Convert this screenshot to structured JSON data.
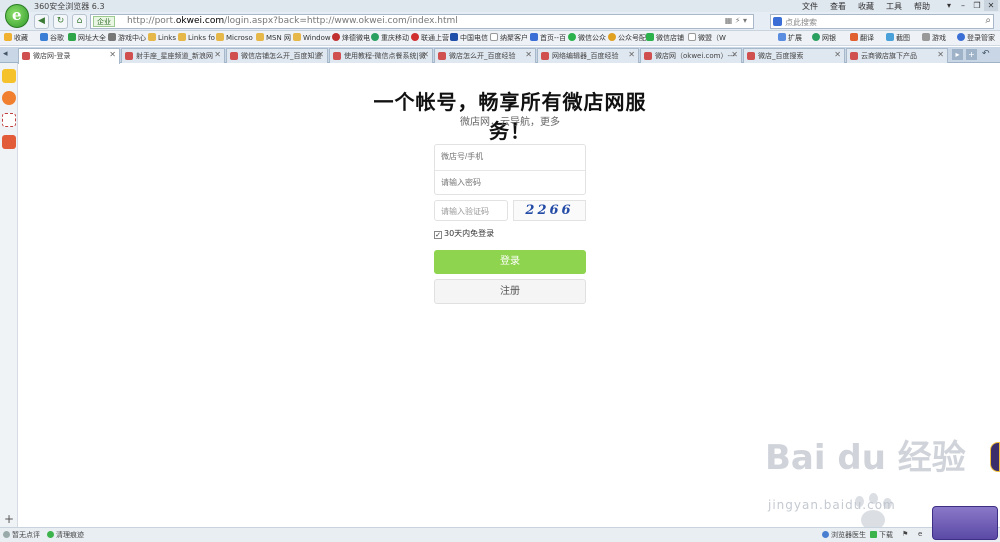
{
  "window": {
    "title": "360安全浏览器 6.3",
    "menus": [
      "文件",
      "查看",
      "收藏",
      "工具",
      "帮助"
    ],
    "controls": [
      "▾",
      "–",
      "❐",
      "✕"
    ]
  },
  "navbar": {
    "secure_label": "企业",
    "url_prefix": "http://port.",
    "url_domain": "okwei.com",
    "url_path": "/login.aspx?back=http://www.okwei.com/index.html",
    "search_placeholder": "点此搜索"
  },
  "bookmarks": {
    "left": [
      "收藏",
      "谷歌",
      "网址大全",
      "游戏中心",
      "Links",
      "Links fo",
      "Microso",
      "MSN 网",
      "Window",
      "烽德微电",
      "重庆移动",
      "联通上营",
      "中国电信",
      "纳聚客户",
      "首页--百",
      "微信公众",
      "公众号配",
      "微信店铺",
      "微盟（W"
    ],
    "right": [
      "扩展",
      "网银",
      "翻译",
      "截图",
      "游戏",
      "登录管家"
    ]
  },
  "tabs": [
    {
      "label": "微店网-登录",
      "active": true
    },
    {
      "label": "射手座_星座频道_新浪网",
      "active": false
    },
    {
      "label": "微信店铺怎么开_百度知道",
      "active": false
    },
    {
      "label": "使用教程-微信点餐系统|微",
      "active": false
    },
    {
      "label": "微店怎么开_百度经验",
      "active": false
    },
    {
      "label": " 网络编辑器_百度经验",
      "active": false
    },
    {
      "label": "微店网（okwei.com）---",
      "active": false
    },
    {
      "label": "微店_百度搜索",
      "active": false
    },
    {
      "label": "云商微店旗下产品",
      "active": false
    }
  ],
  "page": {
    "headline": "一个帐号，畅享所有微店网服务！",
    "subheadline": "微店网，云导航，更多",
    "account_placeholder": "微店号/手机",
    "password_placeholder": "请输入密码",
    "verify_placeholder": "请输入验证码",
    "captcha_text": "2266",
    "remember_label": "30天内免登录",
    "remember_checked": true,
    "login_button": "登录",
    "register_button": "注册",
    "login_color": "#8fd44f"
  },
  "statusbar": {
    "left1": "暂无点评",
    "left2": "清理痕迹",
    "right1": "浏览器医生",
    "right2": "下载"
  },
  "watermark": {
    "main": "Bai du 经验",
    "sub": "jingyan.baidu.com"
  }
}
